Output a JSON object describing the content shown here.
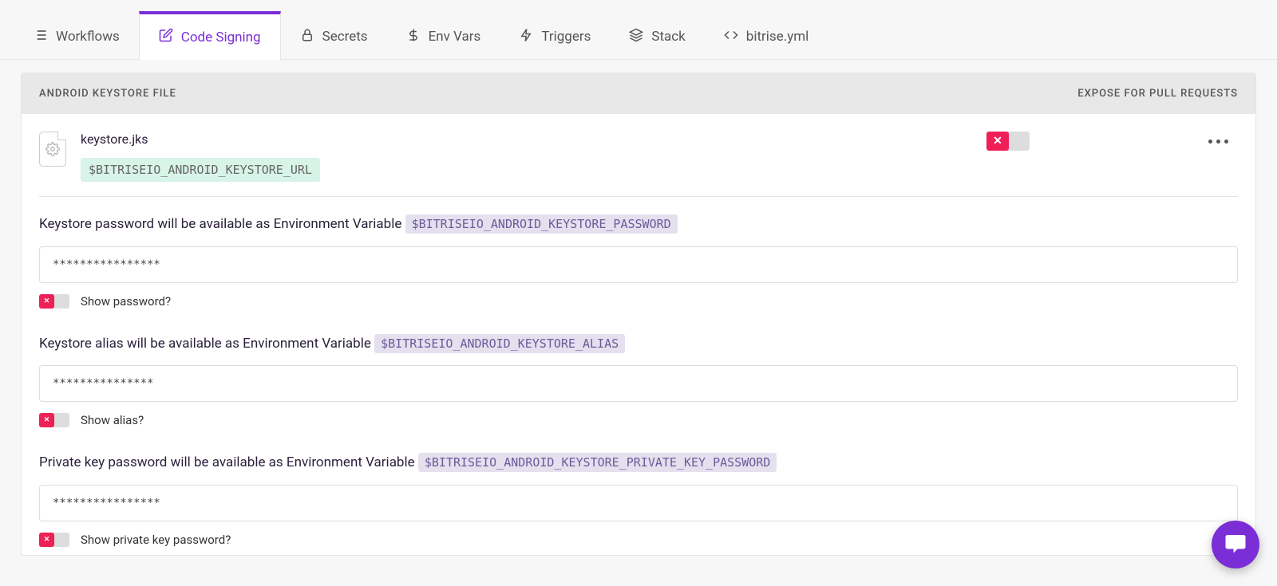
{
  "nav": {
    "tabs": [
      {
        "label": "Workflows"
      },
      {
        "label": "Code Signing"
      },
      {
        "label": "Secrets"
      },
      {
        "label": "Env Vars"
      },
      {
        "label": "Triggers"
      },
      {
        "label": "Stack"
      },
      {
        "label": "bitrise.yml"
      }
    ],
    "active_index": 1
  },
  "panel": {
    "header_left": "ANDROID KEYSTORE FILE",
    "header_right": "EXPOSE FOR PULL REQUESTS"
  },
  "file": {
    "name": "keystore.jks",
    "env_url": "$BITRISEIO_ANDROID_KEYSTORE_URL"
  },
  "fields": [
    {
      "label_prefix": "Keystore password will be available as Environment Variable ",
      "env_var": "$BITRISEIO_ANDROID_KEYSTORE_PASSWORD",
      "value": "****************",
      "show_label": "Show password?"
    },
    {
      "label_prefix": "Keystore alias will be available as Environment Variable ",
      "env_var": "$BITRISEIO_ANDROID_KEYSTORE_ALIAS",
      "value": "***************",
      "show_label": "Show alias?"
    },
    {
      "label_prefix": "Private key password will be available as Environment Variable ",
      "env_var": "$BITRISEIO_ANDROID_KEYSTORE_PRIVATE_KEY_PASSWORD",
      "value": "****************",
      "show_label": "Show private key password?"
    }
  ]
}
